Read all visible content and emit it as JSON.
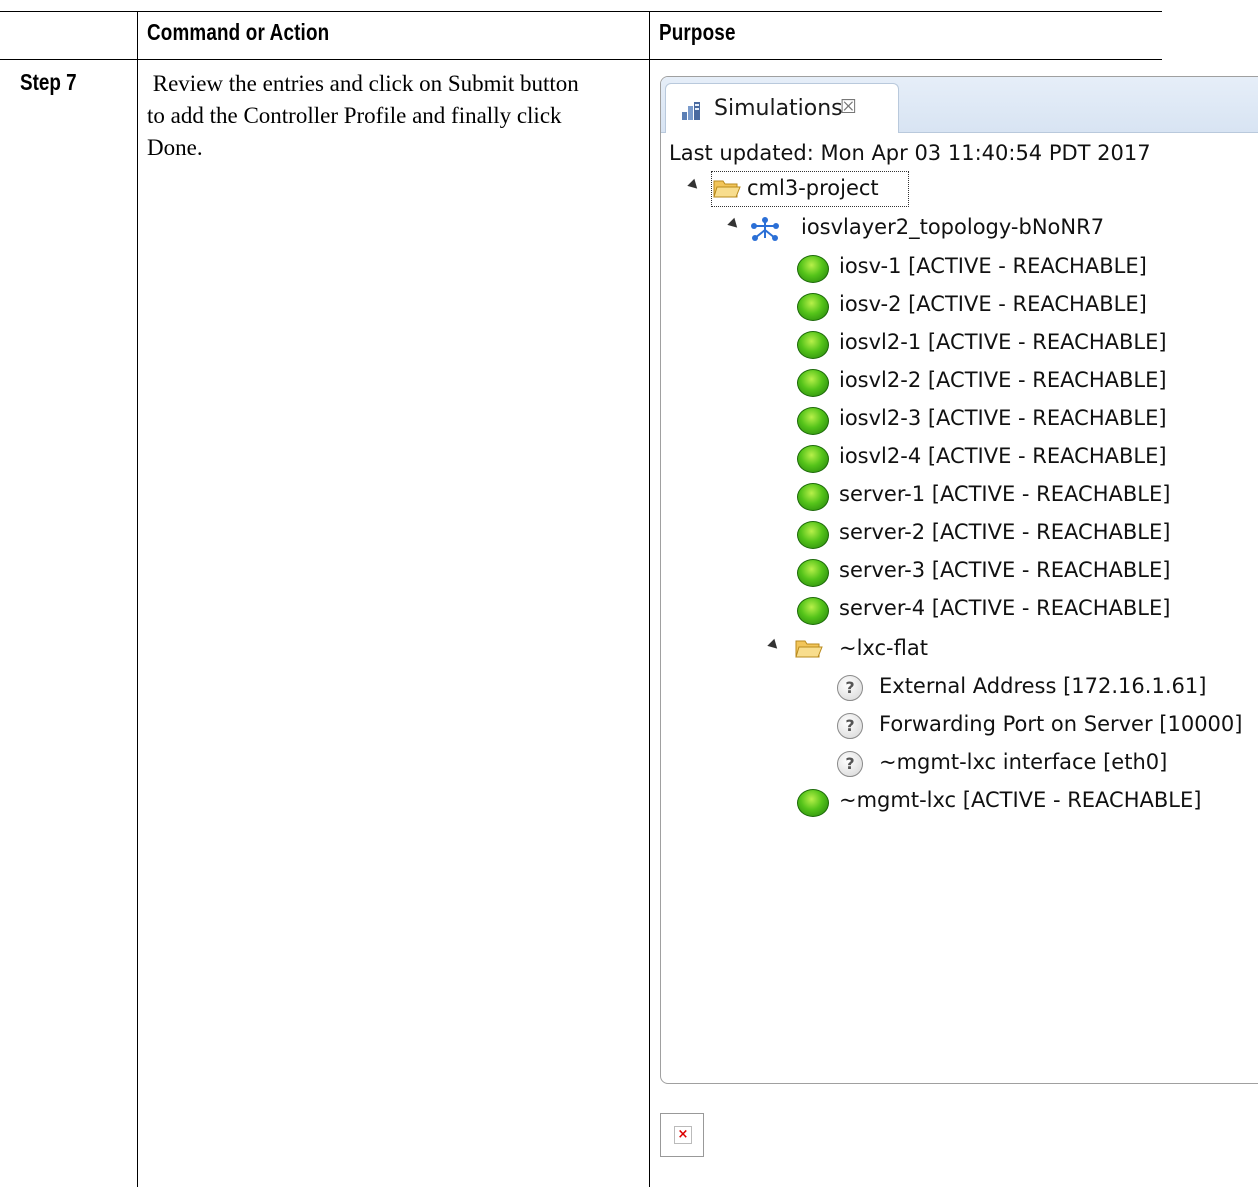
{
  "table": {
    "header_command": "Command or Action",
    "header_purpose": "Purpose",
    "step": "Step 7",
    "description_lines": [
      " Review the entries and click on Submit button",
      "to add the Controller Profile and finally click",
      "Done."
    ]
  },
  "simulations": {
    "tab_title": "Simulations",
    "tab_close_glyph": "☒",
    "last_updated": "Last updated: Mon Apr 03 11:40:54 PDT 2017",
    "project": "cml3-project",
    "topology": "iosvlayer2_topology-bNoNR7",
    "nodes": [
      "iosv-1  [ACTIVE - REACHABLE]",
      "iosv-2  [ACTIVE - REACHABLE]",
      "iosvl2-1  [ACTIVE - REACHABLE]",
      "iosvl2-2  [ACTIVE - REACHABLE]",
      "iosvl2-3  [ACTIVE - REACHABLE]",
      "iosvl2-4  [ACTIVE - REACHABLE]",
      "server-1  [ACTIVE - REACHABLE]",
      "server-2  [ACTIVE - REACHABLE]",
      "server-3  [ACTIVE - REACHABLE]",
      "server-4  [ACTIVE - REACHABLE]"
    ],
    "lxc_folder": "~lxc-flat",
    "lxc_items": [
      "External Address  [172.16.1.61]",
      "Forwarding Port on Server  [10000]",
      "~mgmt-lxc interface  [eth0]"
    ],
    "mgmt_node": "~mgmt-lxc  [ACTIVE - REACHABLE]",
    "status_color": "#3fae12"
  },
  "broken_image_glyph": "×"
}
